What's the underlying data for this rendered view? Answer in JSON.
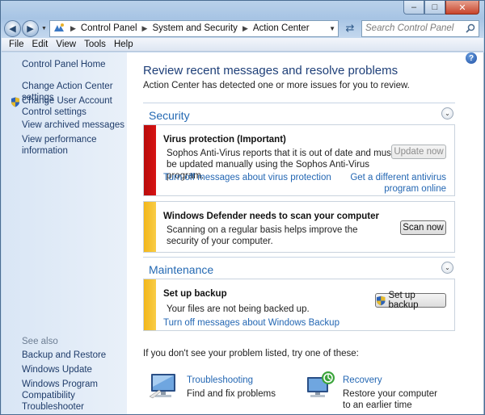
{
  "window": {
    "caption_buttons": [
      "minimize",
      "maximize",
      "close"
    ]
  },
  "navigation": {
    "breadcrumbs": [
      "Control Panel",
      "System and Security",
      "Action Center"
    ],
    "search_placeholder": "Search Control Panel"
  },
  "menubar": {
    "items": [
      "File",
      "Edit",
      "View",
      "Tools",
      "Help"
    ]
  },
  "sidebar": {
    "home": "Control Panel Home",
    "links": [
      "Change Action Center settings",
      "Change User Account Control settings",
      "View archived messages",
      "View performance information"
    ],
    "see_also_label": "See also",
    "see_also": [
      "Backup and Restore",
      "Windows Update",
      "Windows Program Compatibility Troubleshooter"
    ]
  },
  "main": {
    "title": "Review recent messages and resolve problems",
    "subtitle": "Action Center has detected one or more issues for you to review.",
    "security": {
      "title": "Security",
      "virus": {
        "title": "Virus protection  (Important)",
        "text": "Sophos Anti-Virus reports that it is out of date and must be updated manually using the Sophos Anti-Virus program.",
        "button": "Update now",
        "link_off": "Turn off messages about virus protection",
        "link_alt": "Get a different antivirus program online",
        "color": "#c80f0f"
      },
      "defender": {
        "title": "Windows Defender needs to scan your computer",
        "text": "Scanning on a regular basis helps improve the security of your computer.",
        "button": "Scan now",
        "color": "#f5c12e"
      }
    },
    "maintenance": {
      "title": "Maintenance",
      "backup": {
        "title": "Set up backup",
        "text": "Your files are not being backed up.",
        "button": "Set up backup",
        "link_off": "Turn off messages about Windows Backup",
        "color": "#f5c12e"
      }
    },
    "footer": {
      "prompt": "If you don't see your problem listed, try one of these:",
      "troubleshooting": {
        "title": "Troubleshooting",
        "desc": "Find and fix problems"
      },
      "recovery": {
        "title": "Recovery",
        "desc": "Restore your computer to an earlier time"
      }
    }
  }
}
